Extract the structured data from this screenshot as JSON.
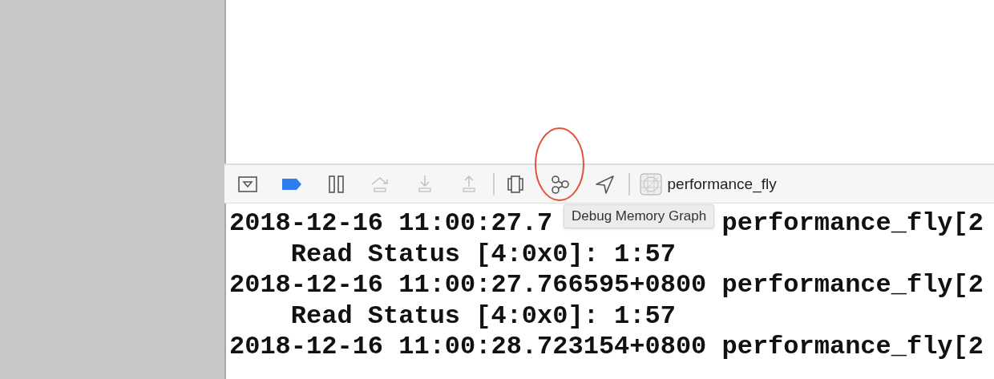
{
  "debug_bar": {
    "buttons": [
      {
        "kind": "hide-console",
        "disabled": false
      },
      {
        "kind": "breakpoints",
        "on": true
      },
      {
        "kind": "pause",
        "disabled": false
      },
      {
        "kind": "step-over",
        "disabled": true
      },
      {
        "kind": "step-into",
        "disabled": true
      },
      {
        "kind": "step-out",
        "disabled": true
      },
      {
        "kind": "divider"
      },
      {
        "kind": "view-debugger",
        "disabled": false
      },
      {
        "kind": "memory-graph",
        "disabled": false
      },
      {
        "kind": "location",
        "disabled": false
      },
      {
        "kind": "divider"
      }
    ],
    "scheme": "performance_fly"
  },
  "tooltip": "Debug Memory Graph",
  "console": {
    "lines": [
      {
        "kind": "entry",
        "text": "2018-12-16 11:00:27.7",
        "text_2": "performance_fly[2"
      },
      {
        "kind": "detail",
        "text": "Read Status [4:0x0]: 1:57"
      },
      {
        "kind": "entry",
        "text": "2018-12-16 11:00:27.766595+0800 performance_fly[2"
      },
      {
        "kind": "detail",
        "text": "Read Status [4:0x0]: 1:57"
      },
      {
        "kind": "entry",
        "text": "2018-12-16 11:00:28.723154+0800 performance_fly[2"
      }
    ]
  }
}
